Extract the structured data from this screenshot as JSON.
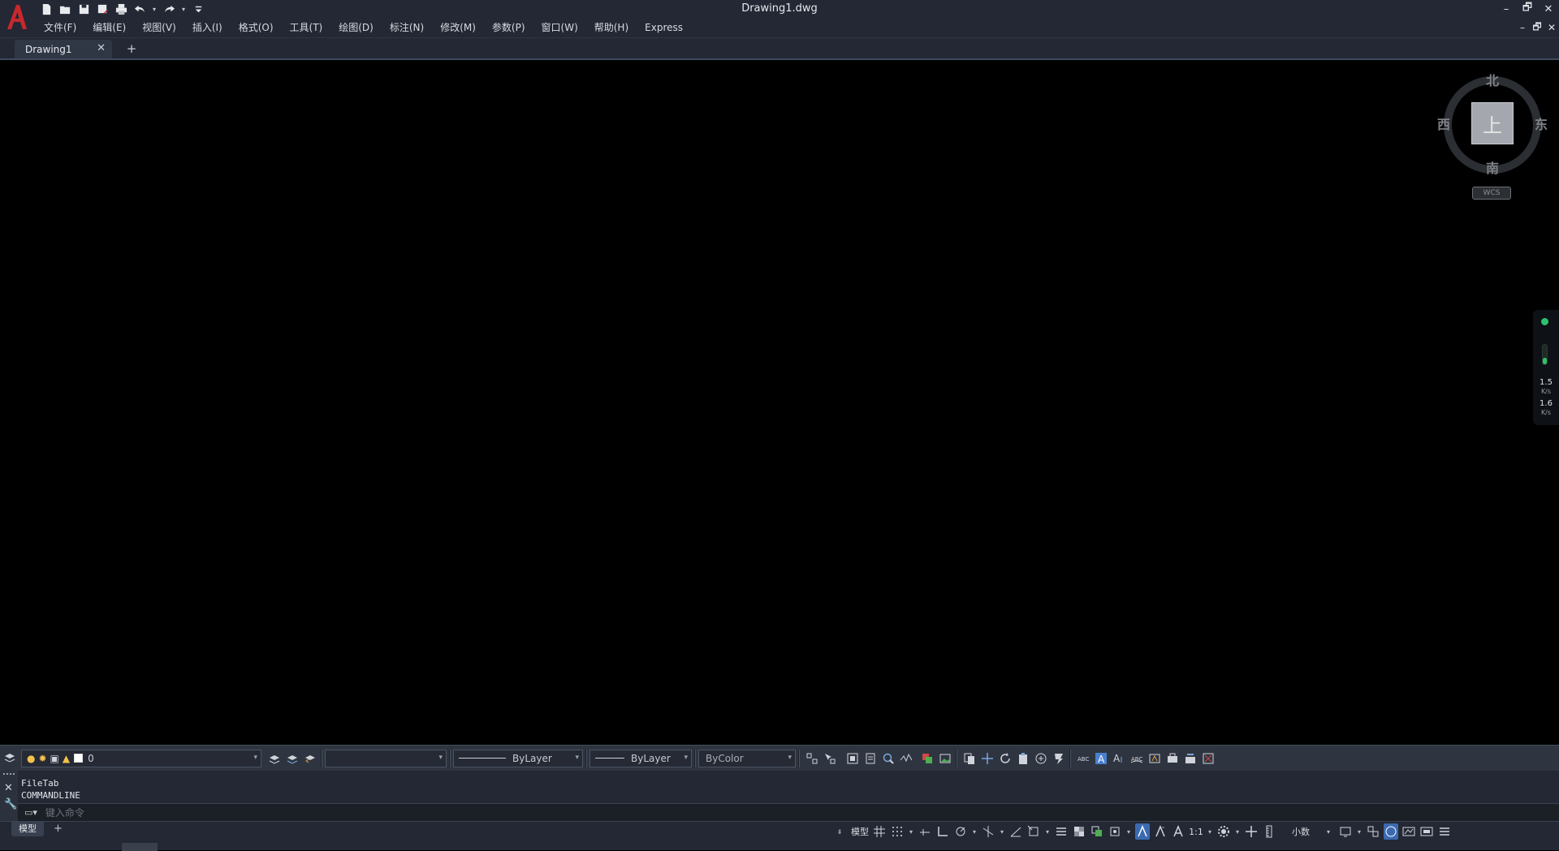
{
  "app": {
    "title": "Drawing1.dwg"
  },
  "window_controls": {
    "minimize": "–",
    "restore": "🗗",
    "close": "✕"
  },
  "doc_controls": {
    "minimize": "–",
    "restore": "🗗",
    "close": "✕"
  },
  "menu": [
    "文件(F)",
    "编辑(E)",
    "视图(V)",
    "插入(I)",
    "格式(O)",
    "工具(T)",
    "绘图(D)",
    "标注(N)",
    "修改(M)",
    "参数(P)",
    "窗口(W)",
    "帮助(H)",
    "Express"
  ],
  "tabs": {
    "active": "Drawing1",
    "close": "✕",
    "add": "+"
  },
  "viewcube": {
    "north": "北",
    "south": "南",
    "east": "东",
    "west": "西",
    "face": "上",
    "wcs": "WCS"
  },
  "netmon": {
    "up_value": "1.5",
    "up_unit": "K/s",
    "down_value": "1.6",
    "down_unit": "K/s"
  },
  "properties": {
    "layer": "0",
    "linetype1": "ByLayer",
    "linetype2": "ByLayer",
    "color": "ByColor"
  },
  "command": {
    "history": [
      "FileTab",
      "COMMANDLINE"
    ],
    "placeholder": "键入命令"
  },
  "status": {
    "layout_tab": "模型",
    "add_layout": "+",
    "model_label": "模型",
    "scale": "1:1",
    "units": "小数"
  }
}
